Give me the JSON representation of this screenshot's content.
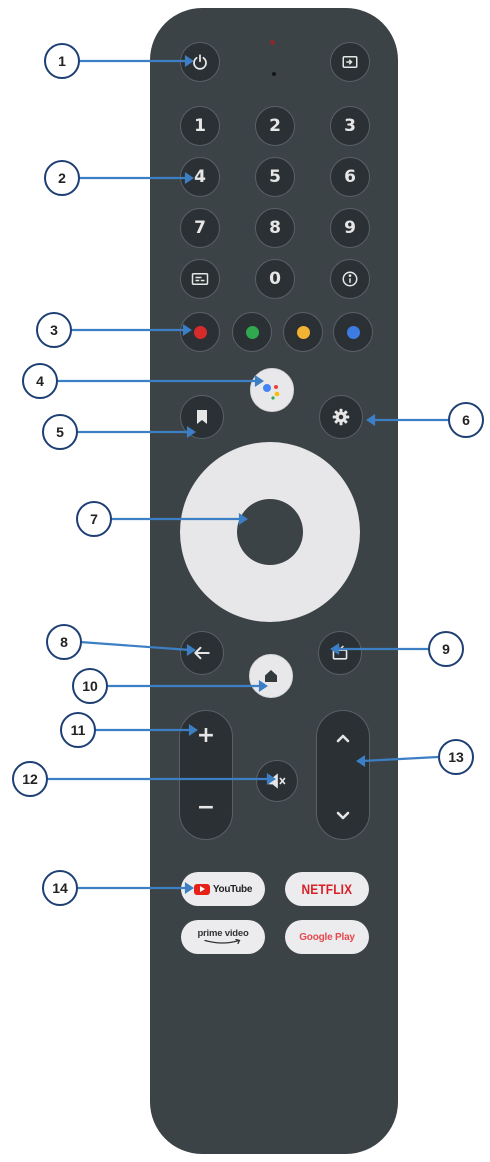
{
  "keypad": {
    "row1": [
      "1",
      "2",
      "3"
    ],
    "row2": [
      "4",
      "5",
      "6"
    ],
    "row3": [
      "7",
      "8",
      "9"
    ],
    "zero": "0"
  },
  "color_buttons": [
    "#d62b2b",
    "#2fa84f",
    "#f2b233",
    "#3c7be0"
  ],
  "assistant_colors": [
    "#4285f4",
    "#ea4335",
    "#fbbc05",
    "#34a853"
  ],
  "apps": {
    "youtube": "YouTube",
    "netflix": "NETFLIX",
    "prime_line1": "prime video",
    "google_play": "Google Play"
  },
  "callouts": [
    "1",
    "2",
    "3",
    "4",
    "5",
    "6",
    "7",
    "8",
    "9",
    "10",
    "11",
    "12",
    "13",
    "14"
  ],
  "colors": {
    "remote_body": "#3c4347",
    "button": "#2a3033",
    "leader_line": "#3d7fc4",
    "callout_border": "#1e3f74",
    "youtube_red": "#e62117",
    "netflix_red": "#d81f26",
    "google_play_red": "#e5484d"
  },
  "icons": [
    "power-icon",
    "input-icon",
    "subtitles-icon",
    "info-icon",
    "assistant-icon",
    "bookmark-icon",
    "settings-icon",
    "back-arrow-icon",
    "home-icon",
    "live-tv-icon",
    "mute-icon",
    "chevron-up-icon",
    "chevron-down-icon"
  ]
}
